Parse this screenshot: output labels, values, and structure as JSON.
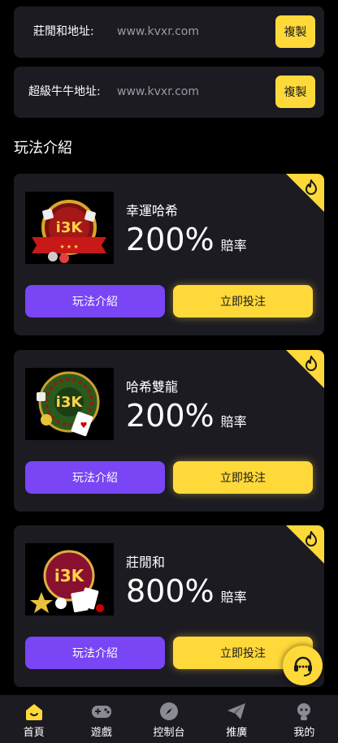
{
  "addresses": [
    {
      "label": "莊閒和地址:",
      "value": "www.kvxr.com",
      "copy_label": "複製"
    },
    {
      "label": "超級牛牛地址:",
      "value": "www.kvxr.com",
      "copy_label": "複製"
    }
  ],
  "section_title": "玩法介紹",
  "games": [
    {
      "name": "幸運哈希",
      "odds": "200%",
      "odds_unit": "賠率",
      "intro_label": "玩法介紹",
      "bet_label": "立即投注"
    },
    {
      "name": "哈希雙龍",
      "odds": "200%",
      "odds_unit": "賠率",
      "intro_label": "玩法介紹",
      "bet_label": "立即投注"
    },
    {
      "name": "莊閒和",
      "odds": "800%",
      "odds_unit": "賠率",
      "intro_label": "玩法介紹",
      "bet_label": "立即投注"
    }
  ],
  "tabs": [
    {
      "label": "首頁",
      "icon": "home-icon",
      "active": true
    },
    {
      "label": "遊戲",
      "icon": "gamepad-icon",
      "active": false
    },
    {
      "label": "控制台",
      "icon": "compass-icon",
      "active": false
    },
    {
      "label": "推廣",
      "icon": "send-icon",
      "active": false
    },
    {
      "label": "我的",
      "icon": "user-icon",
      "active": false
    }
  ],
  "colors": {
    "accent_yellow": "#ffd93a",
    "accent_purple": "#7945f5",
    "card_bg": "#1c1b22",
    "tab_active": "#ffd93a",
    "tab_inactive": "#8a8a94"
  }
}
